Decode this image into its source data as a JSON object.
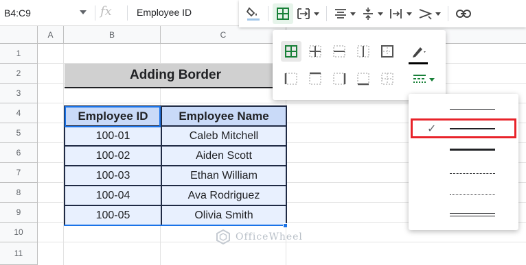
{
  "formula_bar": {
    "name_box": "B4:C9",
    "fx": "fx",
    "content": "Employee ID"
  },
  "columns": [
    "A",
    "B",
    "C"
  ],
  "rows": [
    "1",
    "2",
    "3",
    "4",
    "5",
    "6",
    "7",
    "8",
    "9",
    "10",
    "11"
  ],
  "sheet": {
    "title": "Adding Border",
    "table": {
      "headers": [
        "Employee ID",
        "Employee Name"
      ],
      "rows": [
        [
          "100-01",
          "Caleb Mitchell"
        ],
        [
          "100-02",
          "Aiden Scott"
        ],
        [
          "100-03",
          "Ethan William"
        ],
        [
          "100-04",
          "Ava Rodriguez"
        ],
        [
          "100-05",
          "Olivia Smith"
        ]
      ]
    }
  },
  "watermark": "OfficeWheel",
  "toolbar": {
    "icons": [
      "fill-color-icon",
      "borders-icon",
      "merge-cells-icon",
      "horizontal-align-icon",
      "vertical-align-icon",
      "text-wrapping-icon",
      "text-rotation-icon",
      "insert-link-icon"
    ]
  },
  "borders_panel": {
    "icons": [
      "all-borders-icon",
      "inner-borders-icon",
      "horizontal-borders-icon",
      "vertical-borders-icon",
      "outer-borders-icon",
      "left-border-icon",
      "top-border-icon",
      "right-border-icon",
      "bottom-border-icon",
      "clear-borders-icon",
      "border-color-icon",
      "border-style-icon"
    ]
  },
  "line_styles": {
    "options": [
      "thin-solid",
      "medium-solid",
      "thick-solid",
      "dotted",
      "dashed",
      "double"
    ],
    "selected": "medium-solid"
  },
  "colors": {
    "header_fill": "#c9daf8",
    "body_fill": "#e8f0fe",
    "title_fill": "#d0d0d0",
    "selection": "#1a73e8",
    "highlight": "#e8232a",
    "active_green": "#188038"
  }
}
